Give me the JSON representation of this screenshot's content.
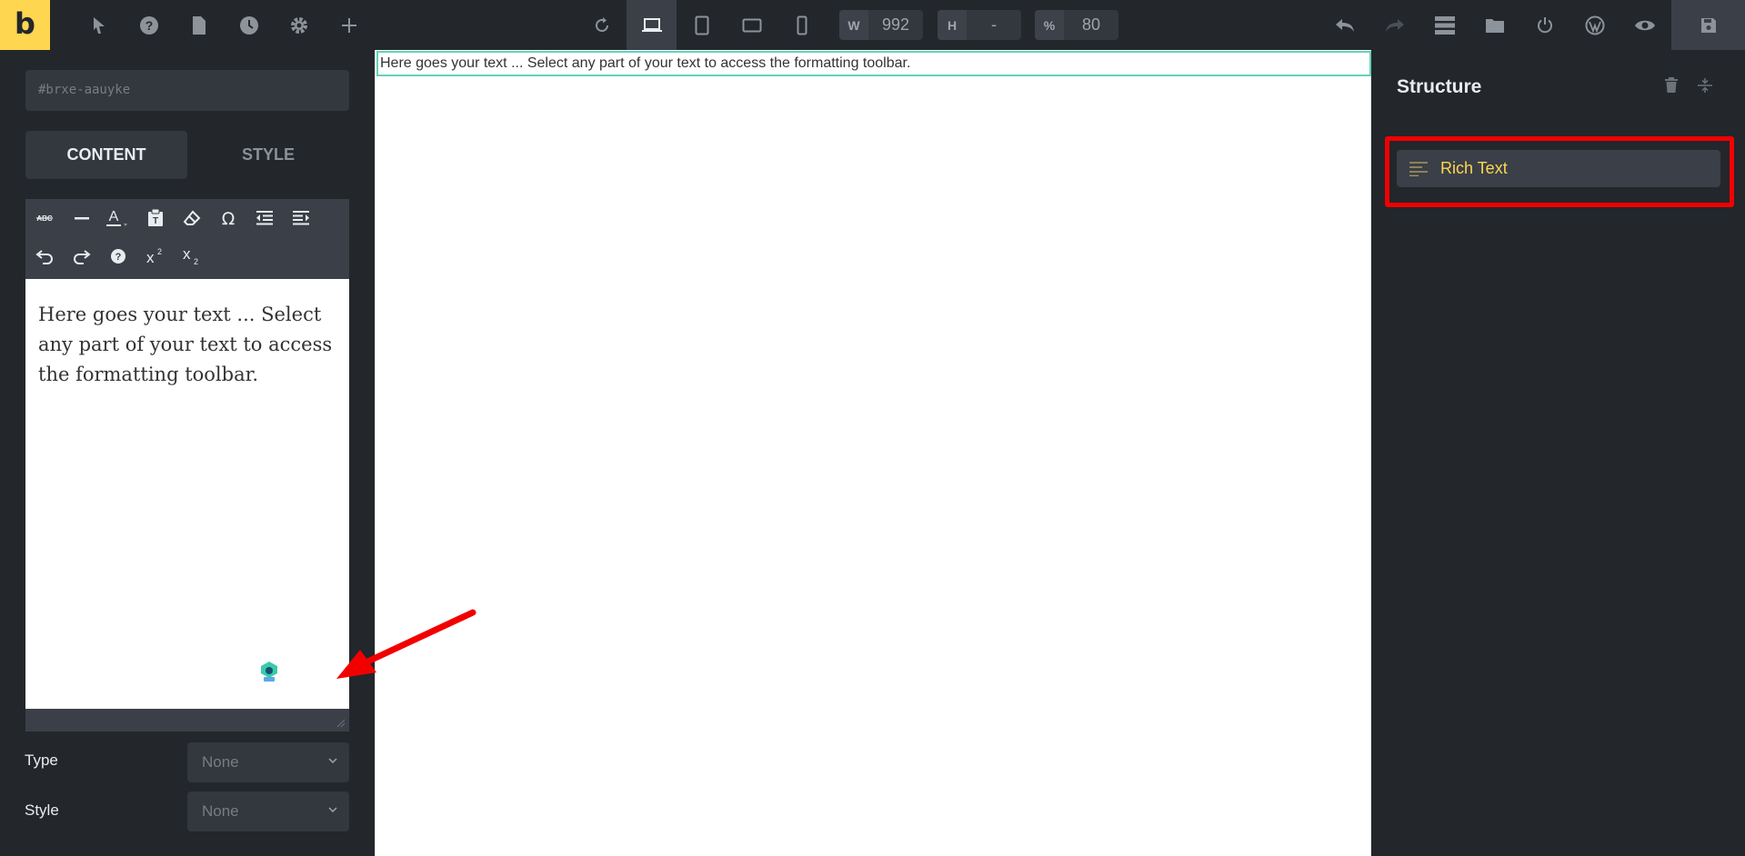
{
  "app": {
    "logo_letter": "b"
  },
  "toolbar": {
    "left_icons": [
      "cursor-icon",
      "help-icon",
      "page-icon",
      "history-icon",
      "settings-icon",
      "add-icon"
    ],
    "center_icons": [
      "reload-icon",
      "laptop-icon",
      "tablet-portrait-icon",
      "tablet-landscape-icon",
      "mobile-icon"
    ],
    "width": {
      "label": "W",
      "value": "992"
    },
    "height": {
      "label": "H",
      "value": "-"
    },
    "zoom": {
      "label": "%",
      "value": "80"
    },
    "right_icons": [
      "undo-icon",
      "redo-icon",
      "layers-icon",
      "folder-icon",
      "power-icon",
      "wordpress-icon",
      "preview-icon"
    ],
    "save_icon": "save-icon"
  },
  "left_panel": {
    "element_id": "#brxe-aauyke",
    "tabs": {
      "content": "CONTENT",
      "style": "STYLE"
    },
    "editor_text": "Here goes your text ... Select any part of your text to access the formatting toolbar.",
    "type_label": "Type",
    "type_value": "None",
    "style_label": "Style",
    "style_value": "None"
  },
  "canvas": {
    "text": "Here goes your text ... Select any part of your text to access the formatting toolbar."
  },
  "right_panel": {
    "title": "Structure",
    "items": [
      {
        "label": "Rich Text",
        "icon": "text-lines-icon"
      }
    ]
  },
  "colors": {
    "accent": "#ffd64f",
    "panel_bg": "#23262b",
    "highlight": "#f20000",
    "canvas_outline": "#64d2b9"
  }
}
